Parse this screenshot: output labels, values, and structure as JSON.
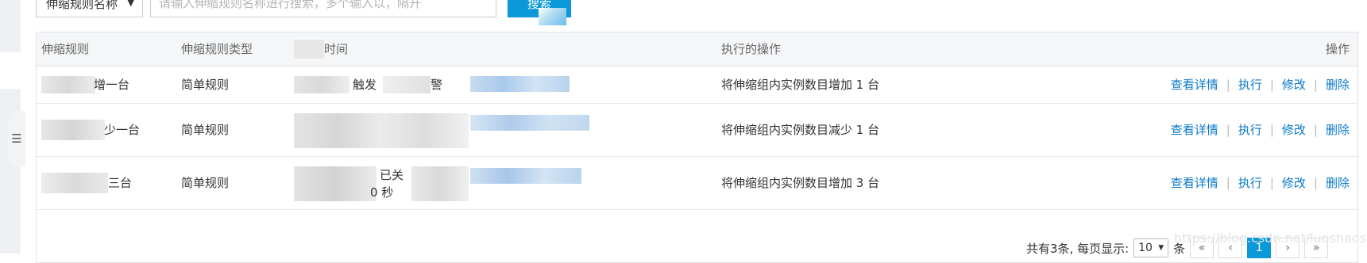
{
  "search": {
    "select_value": "伸缩规则名称",
    "placeholder": "请输入伸缩规则名称进行搜索，多个输入以，隔开",
    "button_label": "搜索"
  },
  "table": {
    "headers": {
      "rule": "伸缩规则",
      "type": "伸缩规则类型",
      "time": "时间",
      "operation": "执行的操作",
      "actions": "操作"
    },
    "rows": [
      {
        "name_visible": "增一台",
        "type": "简单规则",
        "desc_visible": "触发",
        "desc_visible2": "警",
        "operation": "将伸缩组内实例数目增加 1 台"
      },
      {
        "name_visible": "少一台",
        "type": "简单规则",
        "desc_visible": "",
        "desc_visible2": "",
        "operation": "将伸缩组内实例数目减少 1 台"
      },
      {
        "name_visible": "三台",
        "type": "简单规则",
        "desc_visible": "已关",
        "desc_visible2": "0 秒",
        "operation": "将伸缩组内实例数目增加 3 台"
      }
    ],
    "action_labels": {
      "detail": "查看详情",
      "execute": "执行",
      "edit": "修改",
      "delete": "删除",
      "separator": "|"
    }
  },
  "pagination": {
    "total_text": "共有3条, 每页显示:",
    "page_size": "10",
    "unit": "条",
    "first": "«",
    "prev": "‹",
    "current_page": "1",
    "next": "›",
    "last": "»"
  },
  "watermark": "https://blog.csdn.net/luoshaoshuai",
  "colors": {
    "accent": "#0a98d8",
    "link": "#0a78c8"
  }
}
